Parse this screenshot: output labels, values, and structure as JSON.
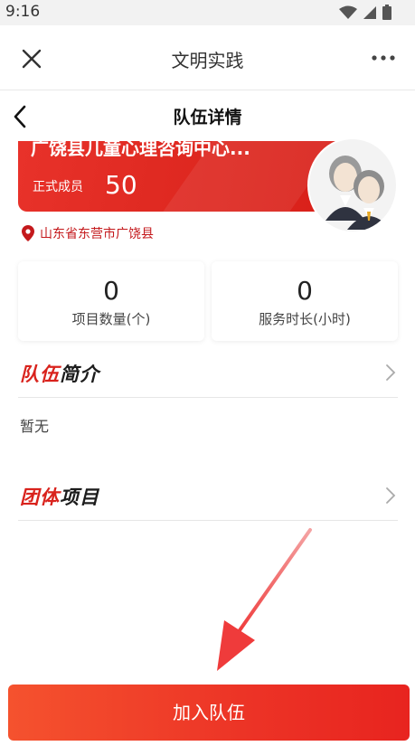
{
  "status": {
    "time": "9:16"
  },
  "app_bar": {
    "title": "文明实践"
  },
  "nav": {
    "title": "队伍详情"
  },
  "team": {
    "name": "广饶县儿童心理咨询中心...",
    "member_label": "正式成员",
    "member_count": "50",
    "location": "山东省东营市广饶县"
  },
  "stats": [
    {
      "value": "0",
      "label": "项目数量(个)"
    },
    {
      "value": "0",
      "label": "服务时长(小时)"
    }
  ],
  "sections": {
    "intro": {
      "title_red": "队伍",
      "title_dark": "简介",
      "content": "暂无"
    },
    "projects": {
      "title_red": "团体",
      "title_dark": "项目"
    }
  },
  "actions": {
    "join_label": "加入队伍"
  },
  "colors": {
    "accent": "#e02a22",
    "location": "#c4191c"
  }
}
